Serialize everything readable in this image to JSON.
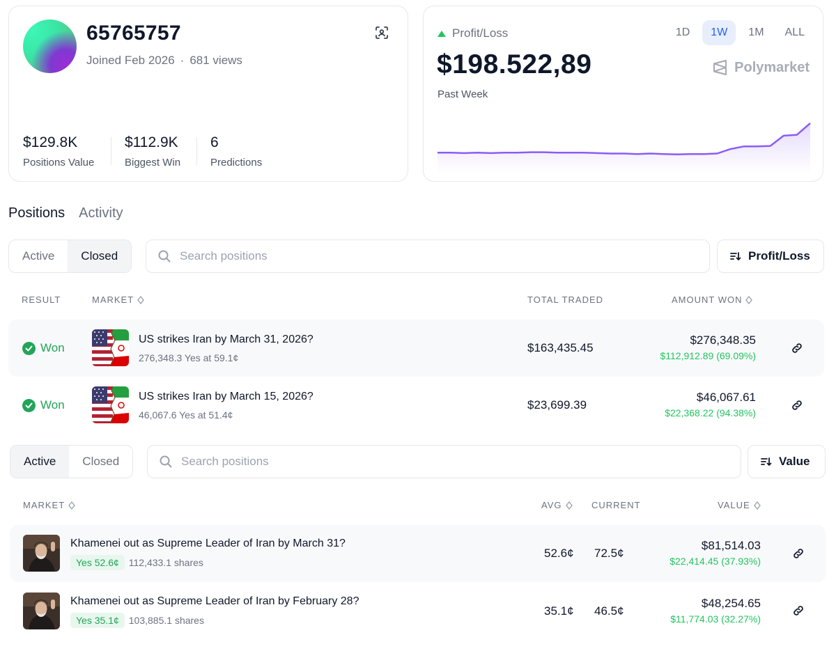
{
  "profile": {
    "username": "65765757",
    "joined": "Joined Feb 2026",
    "views": "681 views",
    "stats": [
      {
        "value": "$129.8K",
        "label": "Positions Value"
      },
      {
        "value": "$112.9K",
        "label": "Biggest Win"
      },
      {
        "value": "6",
        "label": "Predictions"
      }
    ]
  },
  "pnl": {
    "label": "Profit/Loss",
    "value": "$198.522,89",
    "period": "Past Week",
    "ranges": [
      "1D",
      "1W",
      "1M",
      "ALL"
    ],
    "active_range": "1W",
    "brand": "Polymarket",
    "trend_color": "#22c55e",
    "line_color": "#8b5cf6",
    "series": [
      0.34,
      0.34,
      0.33,
      0.34,
      0.33,
      0.34,
      0.34,
      0.35,
      0.35,
      0.34,
      0.34,
      0.34,
      0.33,
      0.32,
      0.32,
      0.31,
      0.32,
      0.31,
      0.3,
      0.31,
      0.31,
      0.32,
      0.42,
      0.48,
      0.48,
      0.49,
      0.72,
      0.74,
      1.0
    ]
  },
  "section_tabs": [
    "Positions",
    "Activity"
  ],
  "closed_panel": {
    "toggle": [
      "Active",
      "Closed"
    ],
    "selected": "Closed",
    "search_placeholder": "Search positions",
    "sort_label": "Profit/Loss",
    "headers": {
      "result": "RESULT",
      "market": "MARKET",
      "total": "TOTAL TRADED",
      "amount": "AMOUNT WON"
    },
    "rows": [
      {
        "result": "Won",
        "title": "US strikes Iran by March 31, 2026?",
        "sub": "276,348.3 Yes at 59.1¢",
        "total": "$163,435.45",
        "amount": "$276,348.35",
        "gain": "$112,912.89 (69.09%)"
      },
      {
        "result": "Won",
        "title": "US strikes Iran by March 15, 2026?",
        "sub": "46,067.6 Yes at 51.4¢",
        "total": "$23,699.39",
        "amount": "$46,067.61",
        "gain": "$22,368.22 (94.38%)"
      }
    ]
  },
  "active_panel": {
    "toggle": [
      "Active",
      "Closed"
    ],
    "selected": "Active",
    "search_placeholder": "Search positions",
    "sort_label": "Value",
    "headers": {
      "market": "MARKET",
      "avg": "AVG",
      "current": "CURRENT",
      "value": "VALUE"
    },
    "rows": [
      {
        "title": "Khamenei out as Supreme Leader of Iran by March 31?",
        "pill": "Yes 52.6¢",
        "shares": "112,433.1 shares",
        "avg": "52.6¢",
        "current": "72.5¢",
        "value": "$81,514.03",
        "gain": "$22,414.45 (37.93%)"
      },
      {
        "title": "Khamenei out as Supreme Leader of Iran by February 28?",
        "pill": "Yes 35.1¢",
        "shares": "103,885.1 shares",
        "avg": "35.1¢",
        "current": "46.5¢",
        "value": "$48,254.65",
        "gain": "$11,774.03 (32.27%)"
      }
    ]
  }
}
